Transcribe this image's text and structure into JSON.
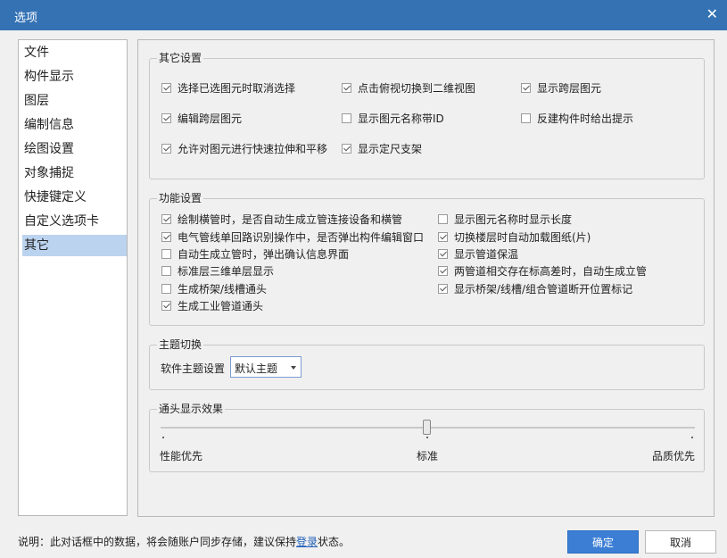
{
  "window": {
    "title": "选项"
  },
  "sidebar": {
    "items": [
      {
        "label": "文件"
      },
      {
        "label": "构件显示"
      },
      {
        "label": "图层"
      },
      {
        "label": "编制信息"
      },
      {
        "label": "绘图设置"
      },
      {
        "label": "对象捕捉"
      },
      {
        "label": "快捷键定义"
      },
      {
        "label": "自定义选项卡"
      },
      {
        "label": "其它",
        "selected": true
      }
    ]
  },
  "other_settings": {
    "title": "其它设置",
    "options": [
      {
        "label": "选择已选图元时取消选择",
        "checked": true
      },
      {
        "label": "点击俯视切换到二维视图",
        "checked": true
      },
      {
        "label": "显示跨层图元",
        "checked": true
      },
      {
        "label": "编辑跨层图元",
        "checked": true
      },
      {
        "label": "显示图元名称带ID",
        "checked": false
      },
      {
        "label": "反建构件时给出提示",
        "checked": false
      },
      {
        "label": "允许对图元进行快速拉伸和平移",
        "checked": true
      },
      {
        "label": "显示定尺支架",
        "checked": true
      }
    ]
  },
  "function_settings": {
    "title": "功能设置",
    "options": [
      {
        "label": "绘制横管时，是否自动生成立管连接设备和横管",
        "checked": true
      },
      {
        "label": "电气管线单回路识别操作中，是否弹出构件编辑窗口",
        "checked": true
      },
      {
        "label": "自动生成立管时，弹出确认信息界面",
        "checked": false
      },
      {
        "label": "标准层三维单层显示",
        "checked": false
      },
      {
        "label": "生成桥架/线槽通头",
        "checked": false
      },
      {
        "label": "生成工业管道通头",
        "checked": true
      },
      {
        "label": "显示图元名称时显示长度",
        "checked": false
      },
      {
        "label": "切换楼层时自动加载图纸(片)",
        "checked": true
      },
      {
        "label": "显示管道保温",
        "checked": true
      },
      {
        "label": "两管道相交存在标高差时，自动生成立管",
        "checked": true
      },
      {
        "label": "显示桥架/线槽/组合管道断开位置标记",
        "checked": true
      }
    ]
  },
  "theme": {
    "title": "主题切换",
    "label": "软件主题设置",
    "value": "默认主题"
  },
  "fitting_display": {
    "title": "通头显示效果",
    "labels": {
      "left": "性能优先",
      "middle": "标准",
      "right": "品质优先"
    },
    "level": 0.5
  },
  "footer": {
    "note_prefix": "说明：此对话框中的数据，将会随账户同步存储，建议保持",
    "note_link": "登录",
    "note_suffix": "状态。",
    "ok_label": "确定",
    "cancel_label": "取消"
  },
  "colors": {
    "titlebar": "#3472b4",
    "selected_item": "#bcd3ef",
    "ok_button": "#3b7ed4"
  }
}
